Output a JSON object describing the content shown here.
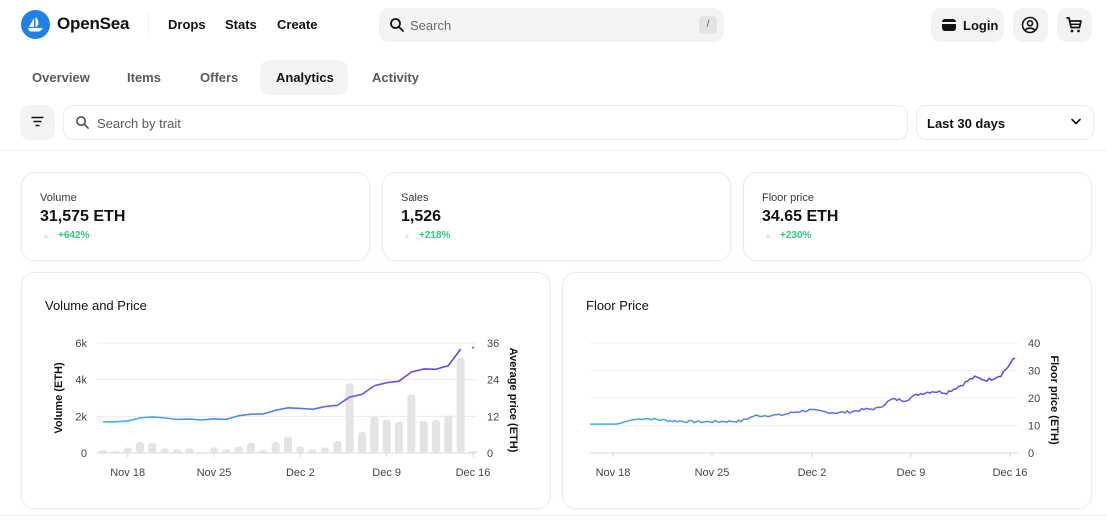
{
  "header": {
    "brand": "OpenSea",
    "nav": [
      "Drops",
      "Stats",
      "Create"
    ],
    "search_placeholder": "Search",
    "search_shortcut": "/",
    "login_label": "Login",
    "icons": [
      "opensea-logo-icon",
      "search-icon",
      "wallet-icon",
      "account-icon",
      "cart-icon"
    ]
  },
  "tabs": [
    {
      "label": "Overview",
      "active": false
    },
    {
      "label": "Items",
      "active": false
    },
    {
      "label": "Offers",
      "active": false
    },
    {
      "label": "Analytics",
      "active": true
    },
    {
      "label": "Activity",
      "active": false
    }
  ],
  "filters": {
    "trait_search_placeholder": "Search by trait",
    "time_range": "Last 30 days"
  },
  "stats": [
    {
      "label": "Volume",
      "value": "31,575 ETH",
      "change": "+642%"
    },
    {
      "label": "Sales",
      "value": "1,526",
      "change": "+218%"
    },
    {
      "label": "Floor price",
      "value": "34.65 ETH",
      "change": "+230%"
    }
  ],
  "colors": {
    "accent": "#2081e2",
    "positive": "#34c77b",
    "line_start": "#3fb6e0",
    "line_end": "#6a3fe0",
    "bar": "#e4e4e6"
  },
  "chart_data": [
    {
      "type": "bar",
      "title": "Volume and Price",
      "xlabel": "",
      "ylabel": "Volume (ETH)",
      "ylabel_right": "Average price (ETH)",
      "ylim": [
        0,
        6000
      ],
      "ylim_right": [
        0,
        36
      ],
      "yticks": [
        "0",
        "2k",
        "4k",
        "6k"
      ],
      "yticks_right": [
        "0",
        "12",
        "24",
        "36"
      ],
      "xticks": [
        "Nov 18",
        "Nov 25",
        "Dec 2",
        "Dec 9",
        "Dec 16"
      ],
      "grid": true,
      "x": [
        "Nov 16",
        "Nov 17",
        "Nov 18",
        "Nov 19",
        "Nov 20",
        "Nov 21",
        "Nov 22",
        "Nov 23",
        "Nov 24",
        "Nov 25",
        "Nov 26",
        "Nov 27",
        "Nov 28",
        "Nov 29",
        "Nov 30",
        "Dec 1",
        "Dec 2",
        "Dec 3",
        "Dec 4",
        "Dec 5",
        "Dec 6",
        "Dec 7",
        "Dec 8",
        "Dec 9",
        "Dec 10",
        "Dec 11",
        "Dec 12",
        "Dec 13",
        "Dec 14",
        "Dec 15",
        "Dec 16"
      ],
      "series": [
        {
          "name": "Volume",
          "kind": "bar",
          "axis": "left",
          "values": [
            150,
            100,
            300,
            600,
            550,
            250,
            200,
            250,
            50,
            300,
            200,
            350,
            550,
            150,
            600,
            900,
            350,
            200,
            300,
            650,
            3800,
            1150,
            2000,
            1800,
            1700,
            3200,
            1750,
            1800,
            2050,
            5200,
            100
          ]
        },
        {
          "name": "Average price",
          "kind": "line",
          "axis": "right",
          "values": [
            10.2,
            10.2,
            10.5,
            11.5,
            11.8,
            11.5,
            11.0,
            11.1,
            10.8,
            11.2,
            11.0,
            12.2,
            12.7,
            12.8,
            14.0,
            14.8,
            14.6,
            14.3,
            15.2,
            15.6,
            18.3,
            19.2,
            22.0,
            23.0,
            23.5,
            26.5,
            27.5,
            27.4,
            28.6,
            34.0,
            34.5
          ]
        }
      ]
    },
    {
      "type": "line",
      "title": "Floor Price",
      "xlabel": "",
      "ylabel": "Floor price (ETH)",
      "ylim": [
        0,
        40
      ],
      "yticks": [
        "0",
        "10",
        "20",
        "30",
        "40"
      ],
      "xticks": [
        "Nov 18",
        "Nov 25",
        "Dec 2",
        "Dec 9",
        "Dec 16"
      ],
      "grid": true,
      "x": [
        "Nov 16",
        "Nov 17",
        "Nov 18",
        "Nov 19",
        "Nov 20",
        "Nov 21",
        "Nov 22",
        "Nov 23",
        "Nov 24",
        "Nov 25",
        "Nov 26",
        "Nov 27",
        "Nov 28",
        "Nov 29",
        "Nov 30",
        "Dec 1",
        "Dec 2",
        "Dec 3",
        "Dec 4",
        "Dec 5",
        "Dec 6",
        "Dec 7",
        "Dec 8",
        "Dec 9",
        "Dec 10",
        "Dec 11",
        "Dec 12",
        "Dec 13",
        "Dec 14",
        "Dec 15",
        "Dec 16"
      ],
      "series": [
        {
          "name": "Floor price",
          "values": [
            10.5,
            10.5,
            10.5,
            12.0,
            12.6,
            12.1,
            11.7,
            11.5,
            11.3,
            11.4,
            11.5,
            11.6,
            13.5,
            13.7,
            13.8,
            15.0,
            15.6,
            15.0,
            14.6,
            15.0,
            15.8,
            16.2,
            19.5,
            19.2,
            21.5,
            22.5,
            22.0,
            24.5,
            27.5,
            26.5,
            28.5,
            34.5
          ]
        }
      ]
    }
  ]
}
